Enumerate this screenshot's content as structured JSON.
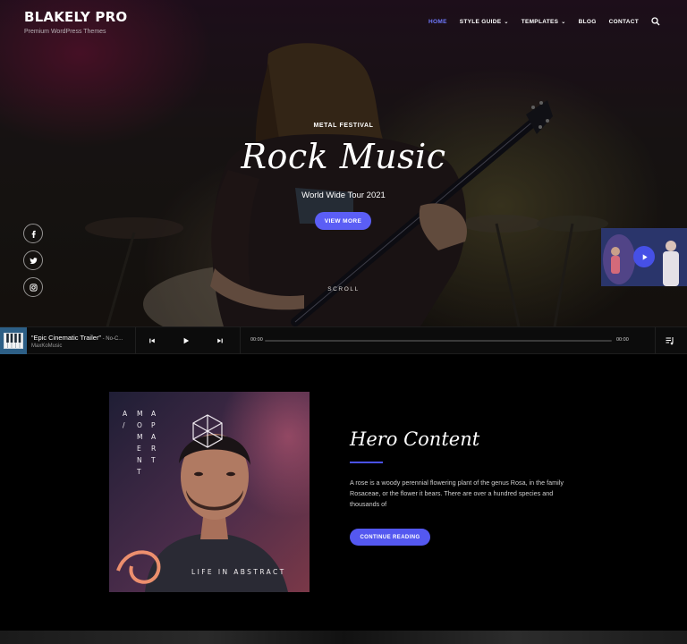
{
  "brand": {
    "title": "BLAKELY PRO",
    "tagline": "Premium WordPress Themes"
  },
  "nav": {
    "items": [
      {
        "label": "HOME",
        "active": true
      },
      {
        "label": "STYLE GUIDE",
        "dropdown": true
      },
      {
        "label": "TEMPLATES",
        "dropdown": true
      },
      {
        "label": "BLOG"
      },
      {
        "label": "CONTACT"
      }
    ],
    "search_icon": "search-icon"
  },
  "hero": {
    "eyebrow": "METAL FESTIVAL",
    "title": "Rock Music",
    "subtitle": "World Wide Tour 2021",
    "button": "VIEW MORE",
    "scroll": "SCROLL"
  },
  "social": [
    "facebook-icon",
    "twitter-icon",
    "instagram-icon"
  ],
  "player": {
    "title": "“Epic Cinematic Trailer”",
    "title_suffix": " - No-C...",
    "artist": "MaxKoMusic",
    "time_current": "00:00",
    "time_total": "00:00",
    "progress": 0
  },
  "content": {
    "cover_left": [
      "A",
      "/",
      "M",
      "E",
      "N",
      "T"
    ],
    "cover_right": [
      "M",
      "O",
      "P",
      "A",
      "R",
      "T"
    ],
    "cover_bottom": "LIFE IN ABSTRACT",
    "title": "Hero Content",
    "body": "A rose is a woody perennial flowering plant of the genus Rosa, in the family Rosaceae, or the flower it bears. There are over a hundred species and thousands of",
    "button": "CONTINUE READING"
  },
  "colors": {
    "accent": "#5b5ef5",
    "nav_active": "#6f79ff"
  }
}
